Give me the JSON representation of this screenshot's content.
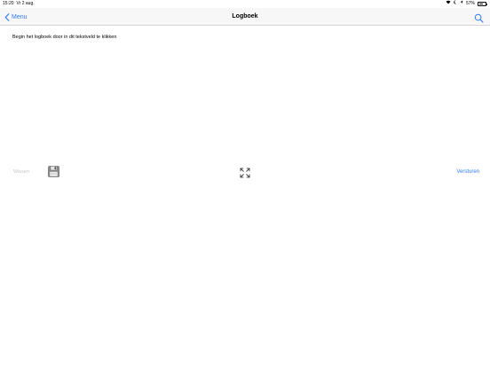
{
  "status_bar": {
    "time": "15:20",
    "date": "Vr 2 aug.",
    "battery_percent": "57%",
    "battery_level": 0.57,
    "icons": [
      "wifi-icon",
      "moon-icon",
      "location-icon",
      "battery-icon"
    ]
  },
  "nav": {
    "back_label": "Menu",
    "title": "Logboek",
    "search_icon": "search-icon"
  },
  "editor": {
    "placeholder": "Begin het logboek door in dit tekstveld te klikken"
  },
  "toolbar": {
    "clear_label": "Wissen",
    "save_icon": "floppy-disk-icon",
    "expand_icon": "expand-icon",
    "send_label": "Versturen"
  },
  "colors": {
    "accent": "#2f7cf6",
    "disabled": "#c6c6c6",
    "navbar_bg": "#f7f7f7"
  }
}
